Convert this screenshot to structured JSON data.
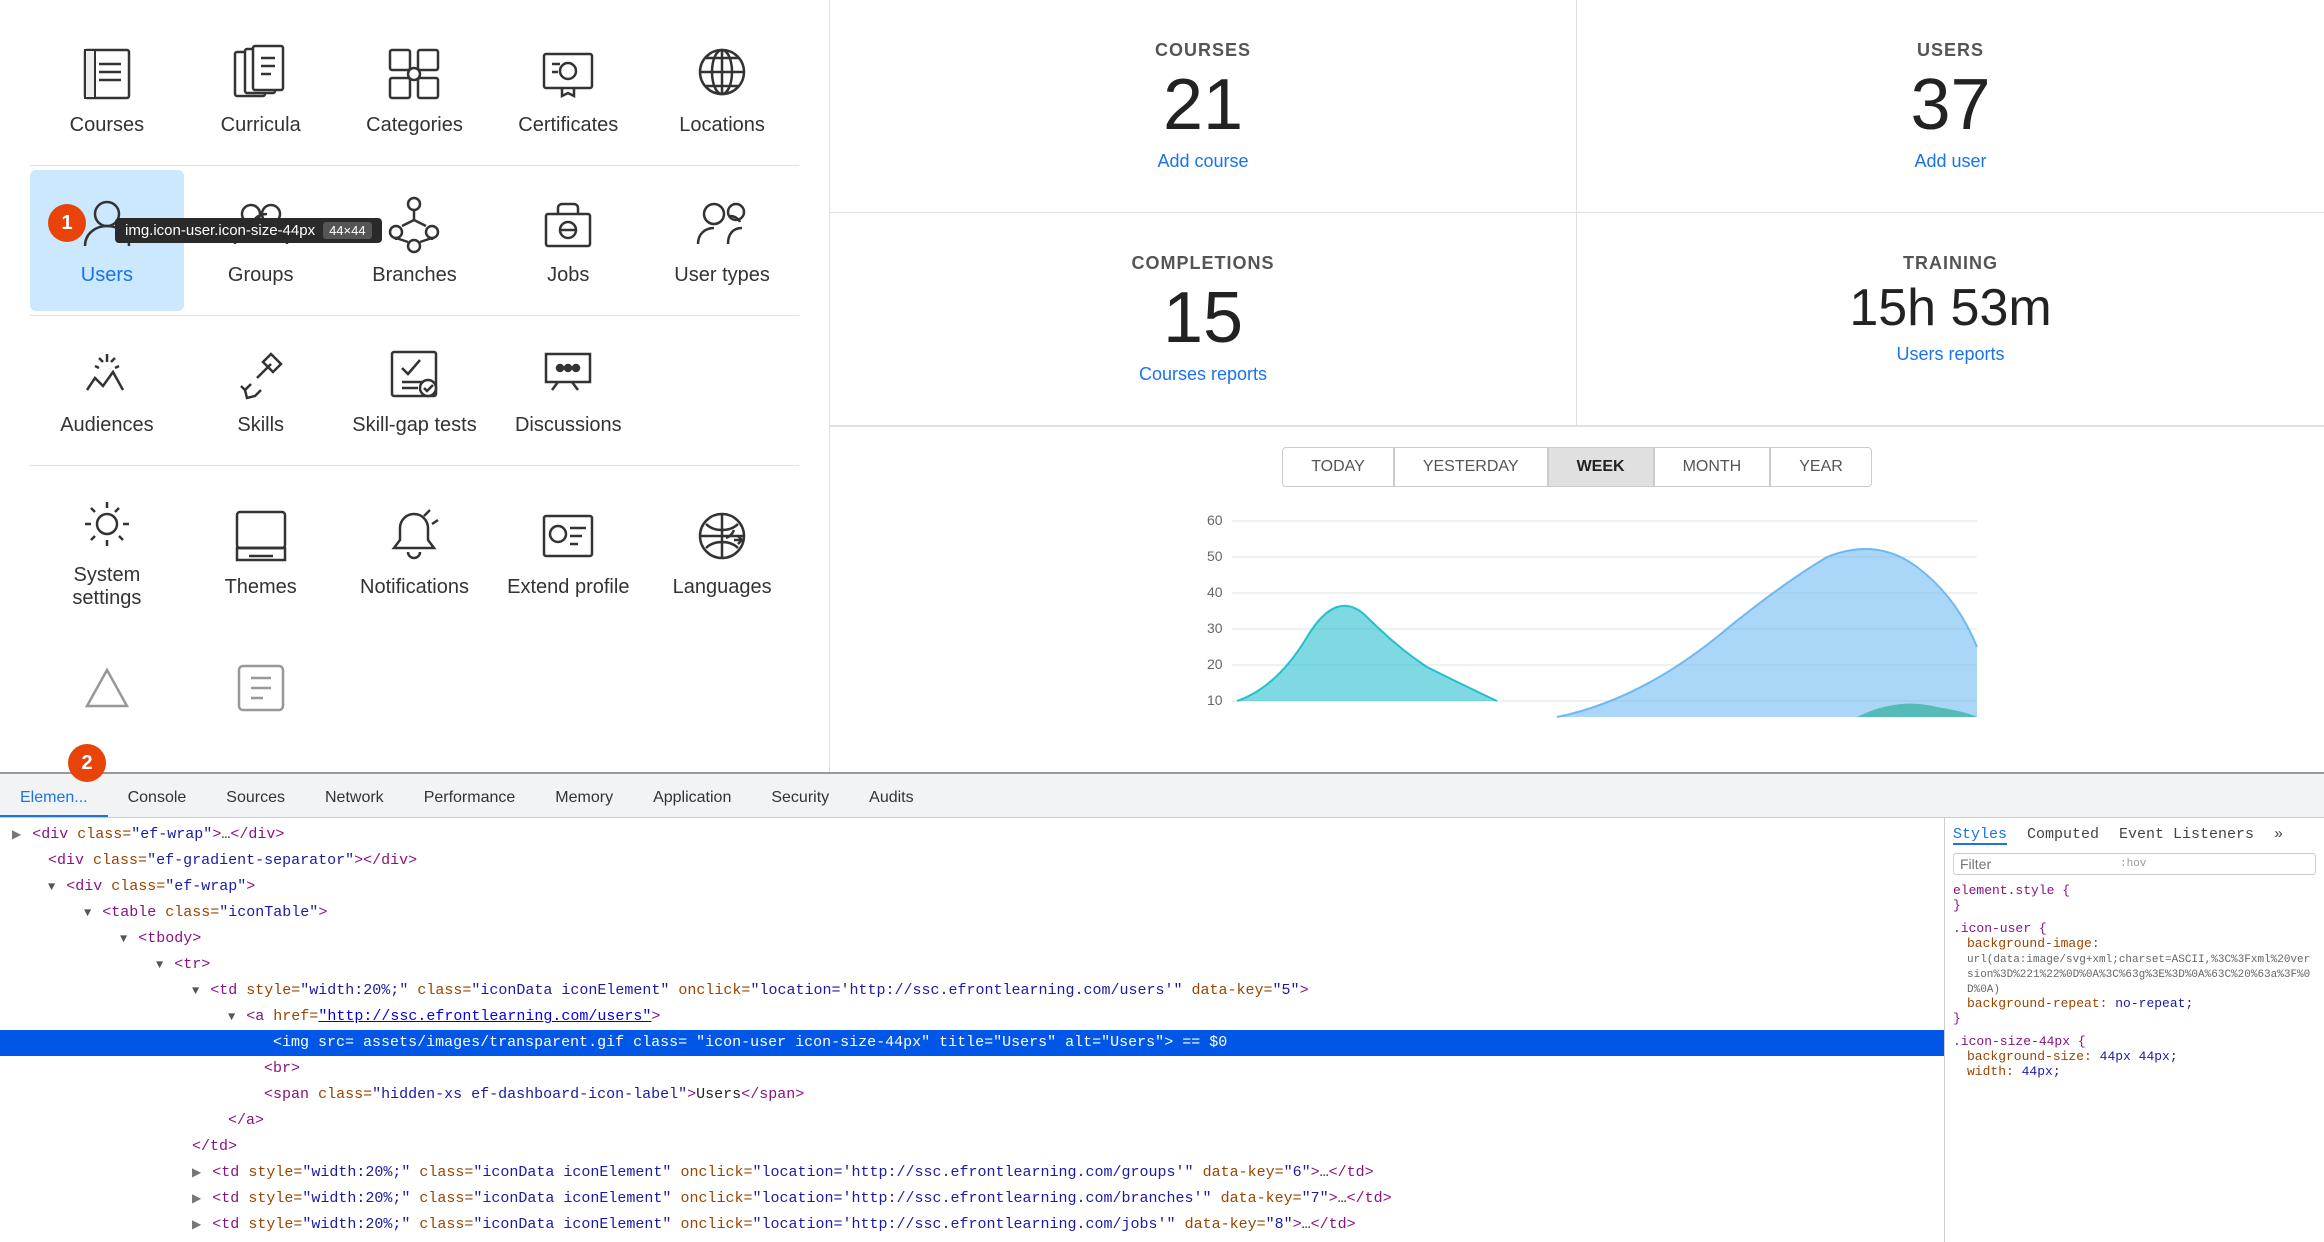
{
  "tooltip": {
    "text": "img.icon-user.icon-size-44px",
    "badge": "44×44"
  },
  "icons_row1": [
    {
      "id": "courses",
      "label": "Courses"
    },
    {
      "id": "curricula",
      "label": "Curricula"
    },
    {
      "id": "categories",
      "label": "Categories"
    },
    {
      "id": "certificates",
      "label": "Certificates"
    },
    {
      "id": "locations",
      "label": "Locations"
    }
  ],
  "icons_row2": [
    {
      "id": "users",
      "label": "Users",
      "active": true
    },
    {
      "id": "groups",
      "label": "Groups"
    },
    {
      "id": "branches",
      "label": "Branches"
    },
    {
      "id": "jobs",
      "label": "Jobs"
    },
    {
      "id": "user-types",
      "label": "User types"
    }
  ],
  "icons_row3": [
    {
      "id": "audiences",
      "label": "Audiences"
    },
    {
      "id": "skills",
      "label": "Skills"
    },
    {
      "id": "skill-gap-tests",
      "label": "Skill-gap tests"
    },
    {
      "id": "discussions",
      "label": "Discussions"
    }
  ],
  "icons_row4": [
    {
      "id": "system-settings",
      "label": "System settings"
    },
    {
      "id": "themes",
      "label": "Themes"
    },
    {
      "id": "notifications",
      "label": "Notifications"
    },
    {
      "id": "extend-profile",
      "label": "Extend profile"
    },
    {
      "id": "languages",
      "label": "Languages"
    }
  ],
  "stats": {
    "courses": {
      "label": "COURSES",
      "value": "21",
      "link": "Add course"
    },
    "users": {
      "label": "USERS",
      "value": "37",
      "link": "Add user"
    },
    "completions": {
      "label": "COMPLETIONS",
      "value": "15",
      "link": "Courses reports"
    },
    "training": {
      "label": "TRAINING",
      "value": "15h 53m",
      "link": "Users reports"
    }
  },
  "time_buttons": [
    "TODAY",
    "YESTERDAY",
    "WEEK",
    "MONTH",
    "YEAR"
  ],
  "active_time": "WEEK",
  "chart": {
    "y_labels": [
      "60",
      "50",
      "40",
      "30",
      "20",
      "10"
    ],
    "y_max": 60
  },
  "devtools": {
    "tabs": [
      "Elemen...",
      "Console",
      "Sources",
      "Network",
      "Performance",
      "Memory",
      "Application",
      "Security",
      "Audits"
    ],
    "active_tab": "Elemen...",
    "code_lines": [
      {
        "indent": 0,
        "content": "<div class=\"ef-wrap\">…</div>"
      },
      {
        "indent": 0,
        "content": "<div class=\"ef-gradient-separator\"></div>"
      },
      {
        "indent": 0,
        "content": "<div class=\"ef-wrap\">"
      },
      {
        "indent": 1,
        "content": "<table class=\"iconTable\">"
      },
      {
        "indent": 2,
        "content": "<tbody>"
      },
      {
        "indent": 3,
        "content": "<tr>"
      },
      {
        "indent": 4,
        "content": "<td style=\"width:20%;\" class=\"iconData iconElement\" onclick=\"location='http://ssc.efrontlearning.com/users'\" data-key=\"5\">"
      },
      {
        "indent": 5,
        "content": "<a href=\"http://ssc.efrontlearning.com/users\">"
      },
      {
        "indent": 6,
        "content": "<img src=\"assets/images/transparent.gif\" class=\"icon-user icon-size-44px\" title=\"Users\" alt=\"Users\"> == $0",
        "highlighted": true
      },
      {
        "indent": 6,
        "content": "<br>"
      },
      {
        "indent": 6,
        "content": "<span class=\"hidden-xs ef-dashboard-icon-label\">Users</span>"
      },
      {
        "indent": 5,
        "content": "</a>"
      },
      {
        "indent": 4,
        "content": "</td>"
      },
      {
        "indent": 4,
        "content": "<td style=\"width:20%;\" class=\"iconData iconElement\" onclick=\"location='http://ssc.efrontlearning.com/groups'\" data-key=\"6\">…</td>"
      },
      {
        "indent": 4,
        "content": "<td style=\"width:20%;\" class=\"iconData iconElement\" onclick=\"location='http://ssc.efrontlearning.com/branches'\" data-key=\"7\">…</td>"
      },
      {
        "indent": 4,
        "content": "<td style=\"width:20%;\" class=\"iconData iconElement\" onclick=\"location='http://ssc.efrontlearning.com/jobs'\" data-key=\"8\">…</td>"
      }
    ],
    "styles": {
      "tabs": [
        "Styles",
        "Computed",
        "Event Listeners",
        "»"
      ],
      "active_tab": "Styles",
      "filter_placeholder": "Filter",
      "rules": [
        {
          "selector": "element.style {",
          "props": []
        },
        {
          "selector": ".icon-user {",
          "props": [
            {
              "name": "background-image:",
              "value": "url(data:image/svg+xml;charset=ASCII,%3C%3Fxml%20version%3D%221%22%0D%0A%3C%63g%3E%3D%0A%63C%20%63a%3F%0D%0A)"
            },
            {
              "name": "background-repeat:",
              "value": "no-repeat;"
            }
          ]
        },
        {
          "selector": ".icon-size-44px {",
          "props": [
            {
              "name": "background-size:",
              "value": "44px 44px;"
            },
            {
              "name": "width:",
              "value": "44px;"
            }
          ]
        }
      ]
    }
  },
  "badge1": "1",
  "badge2": "2"
}
